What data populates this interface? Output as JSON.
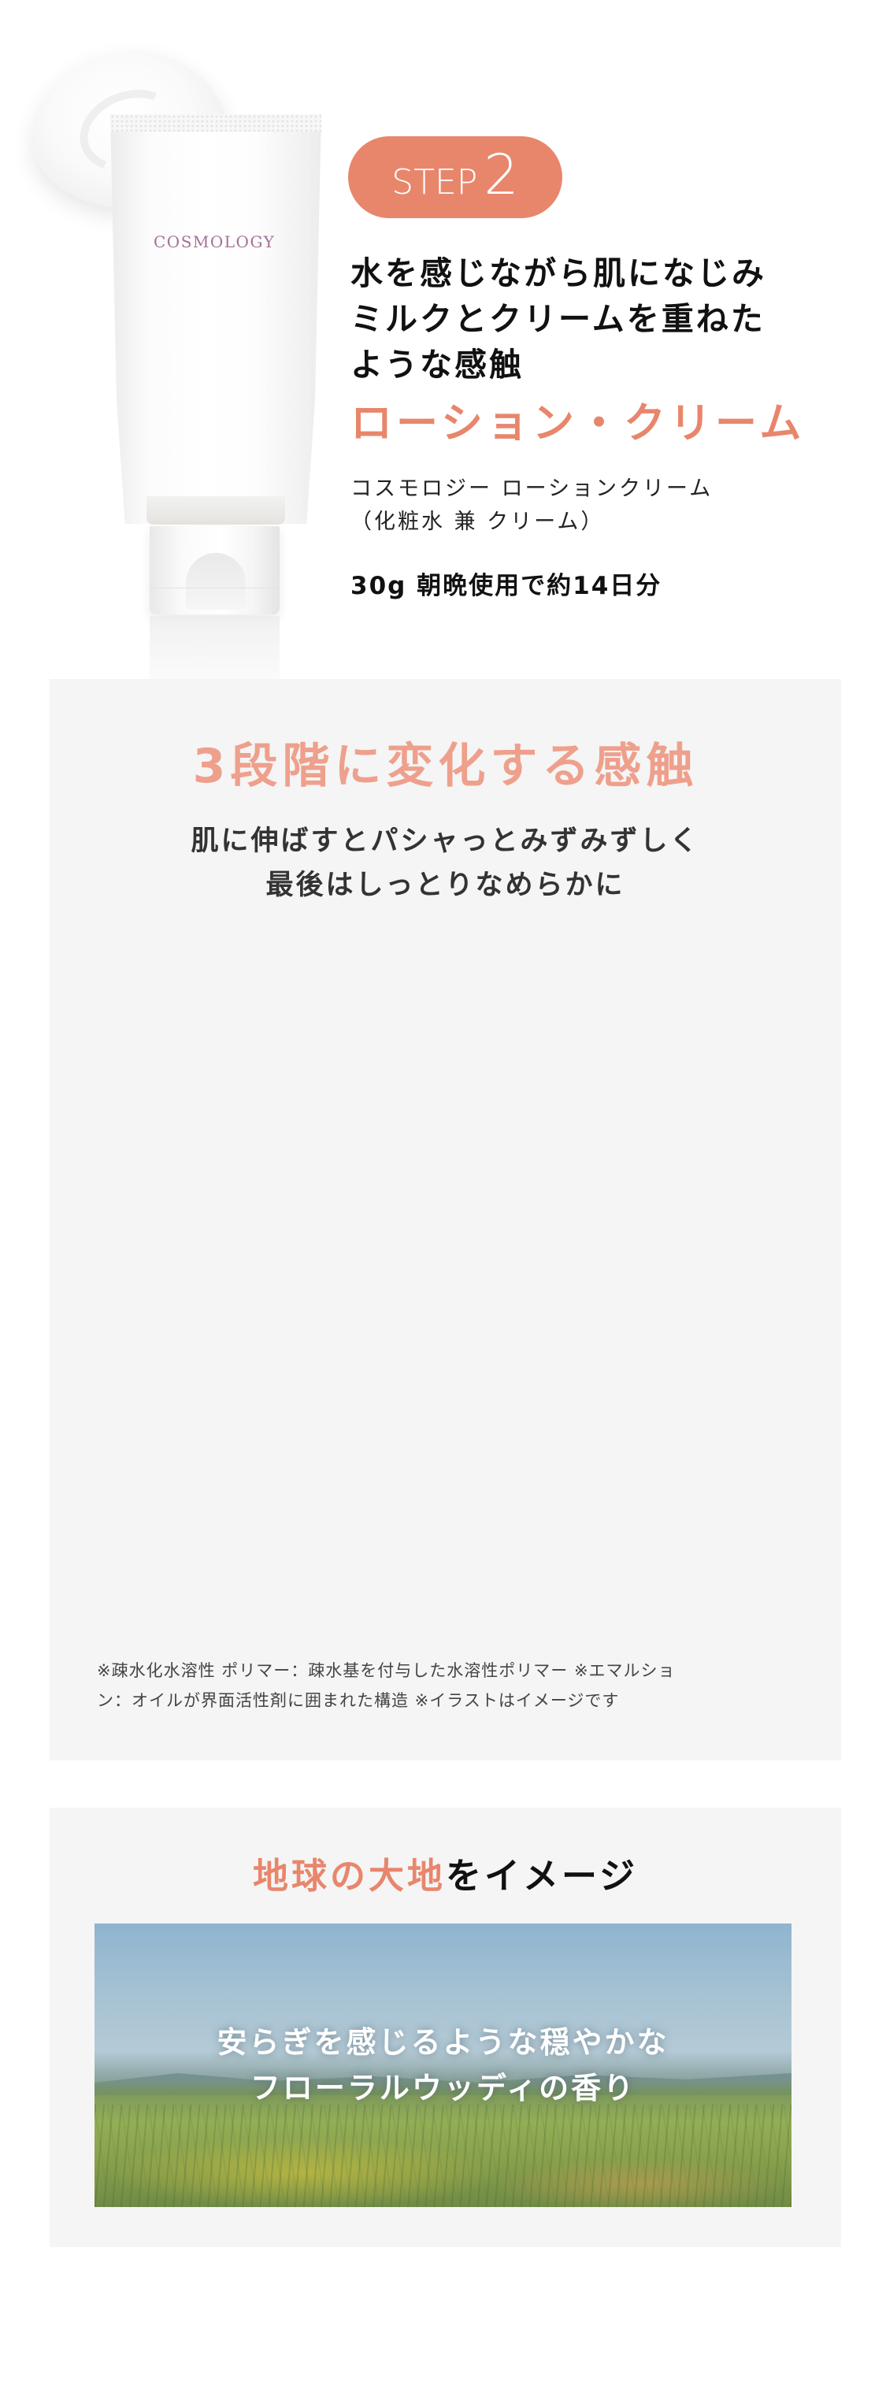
{
  "product_image": {
    "logo_text": "COSMOLOGY"
  },
  "step_badge": {
    "word": "STEP",
    "number": "2"
  },
  "headline": {
    "lines": [
      "水を感じながら肌になじみ",
      "ミルクとクリームを重ねた",
      "ような感触"
    ]
  },
  "product_name": "ローション・クリーム",
  "product_desc": {
    "lines": [
      "コスモロジー ローションクリーム",
      "（化粧水 兼 クリーム）"
    ]
  },
  "product_size": "30g 朝晩使用で約14日分",
  "texture_section": {
    "title": "3段階に変化する感触",
    "subtitle_lines": [
      "肌に伸ばすとパシャっとみずみずしく",
      "最後はしっとりなめらかに"
    ],
    "note_lines": [
      "※疎水化水溶性 ポリマー：疎水基を付与した水溶性ポリマー ※エマルショ",
      "ン：オイルが界面活性剤に囲まれた構造 ※イラストはイメージです"
    ]
  },
  "scent_section": {
    "title_accent": "地球の大地",
    "title_rest": "をイメージ",
    "image_text_lines": [
      "安らぎを感じるような穏やかな",
      "フローラルウッディの香り"
    ]
  },
  "colors": {
    "accent": "#e8866c",
    "accent_light": "#eea08c",
    "panel_bg": "#f5f5f5",
    "logo": "#a56f97"
  }
}
